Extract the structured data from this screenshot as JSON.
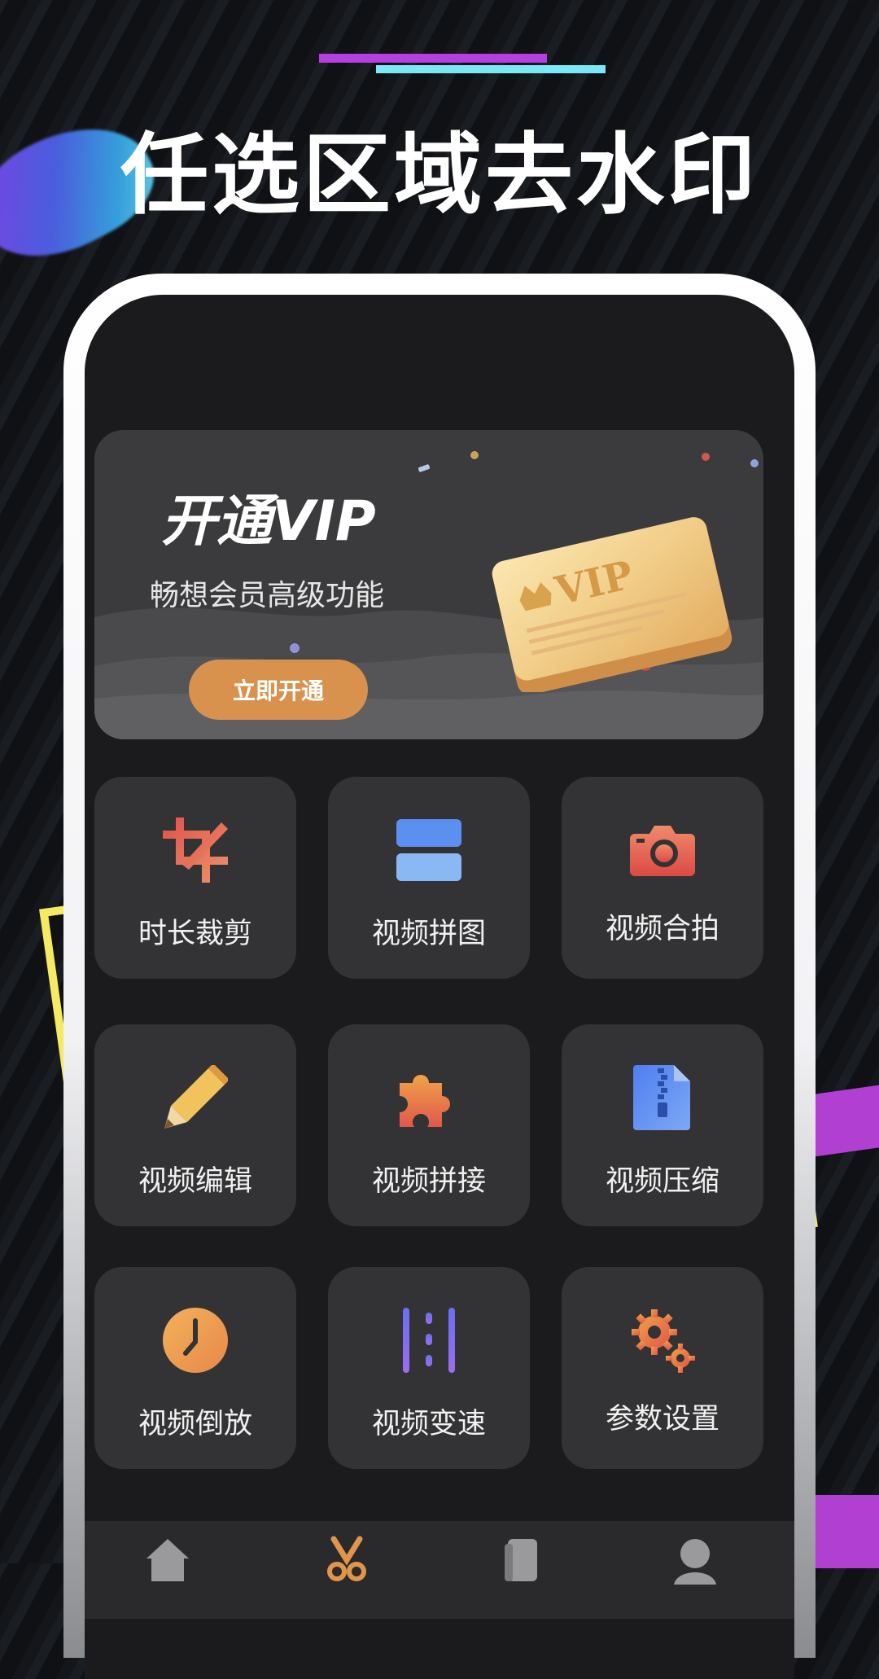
{
  "headline": "任选区域去水印",
  "vip": {
    "title": "开通VIP",
    "subtitle": "畅想会员高级功能",
    "button_label": "立即开通",
    "card_text": "VIP",
    "button_color": "#d9914e"
  },
  "features": [
    {
      "label": "时长裁剪",
      "icon": "crop-icon"
    },
    {
      "label": "视频拼图",
      "icon": "stacked-layout-icon"
    },
    {
      "label": "视频合拍",
      "icon": "camera-icon"
    },
    {
      "label": "视频编辑",
      "icon": "pencil-icon"
    },
    {
      "label": "视频拼接",
      "icon": "puzzle-piece-icon"
    },
    {
      "label": "视频压缩",
      "icon": "zip-file-icon"
    },
    {
      "label": "视频倒放",
      "icon": "clock-icon"
    },
    {
      "label": "视频变速",
      "icon": "speed-bars-icon"
    },
    {
      "label": "参数设置",
      "icon": "gears-icon"
    }
  ],
  "bottom_nav": [
    {
      "icon": "home-icon"
    },
    {
      "icon": "scissors-icon"
    },
    {
      "icon": "document-icon"
    },
    {
      "icon": "profile-icon"
    }
  ],
  "colors": {
    "accent_purple": "#b53fe0",
    "accent_cyan": "#7be7f5",
    "tile_bg": "#333335",
    "screen_bg": "#1b1b1d"
  }
}
